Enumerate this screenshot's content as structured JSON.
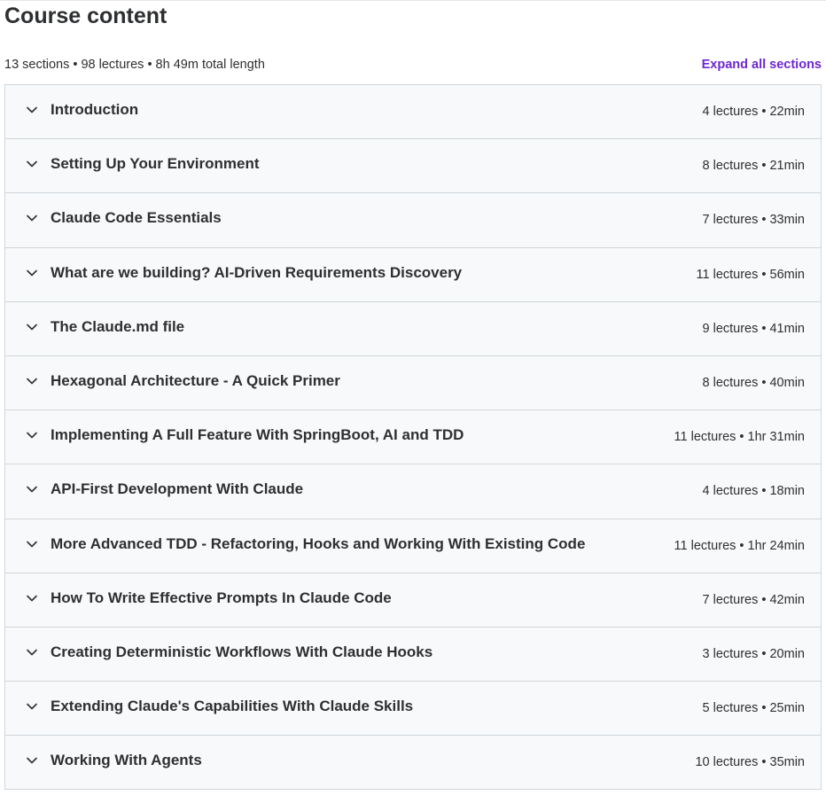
{
  "header": {
    "title": "Course content",
    "summary": "13 sections • 98 lectures • 8h 49m total length",
    "expand_label": "Expand all sections"
  },
  "colors": {
    "accent": "#6d28d2",
    "section_bg": "#f7f9fa",
    "border": "#d1d7dc",
    "text": "#2d2f31"
  },
  "icons": {
    "section_toggle": "chevron-down-icon"
  },
  "sections": [
    {
      "title": "Introduction",
      "meta": "4 lectures • 22min"
    },
    {
      "title": "Setting Up Your Environment",
      "meta": "8 lectures • 21min"
    },
    {
      "title": "Claude Code Essentials",
      "meta": "7 lectures • 33min"
    },
    {
      "title": "What are we building? AI-Driven Requirements Discovery",
      "meta": "11 lectures • 56min"
    },
    {
      "title": "The Claude.md file",
      "meta": "9 lectures • 41min"
    },
    {
      "title": "Hexagonal Architecture - A Quick Primer",
      "meta": "8 lectures • 40min"
    },
    {
      "title": "Implementing A Full Feature With SpringBoot, AI and TDD",
      "meta": "11 lectures • 1hr 31min"
    },
    {
      "title": "API-First Development With Claude",
      "meta": "4 lectures • 18min"
    },
    {
      "title": "More Advanced TDD - Refactoring, Hooks and Working With Existing Code",
      "meta": "11 lectures • 1hr 24min"
    },
    {
      "title": "How To Write Effective Prompts In Claude Code",
      "meta": "7 lectures • 42min"
    },
    {
      "title": "Creating Deterministic Workflows With Claude Hooks",
      "meta": "3 lectures • 20min"
    },
    {
      "title": "Extending Claude's Capabilities With Claude Skills",
      "meta": "5 lectures • 25min"
    },
    {
      "title": "Working With Agents",
      "meta": "10 lectures • 35min"
    }
  ]
}
